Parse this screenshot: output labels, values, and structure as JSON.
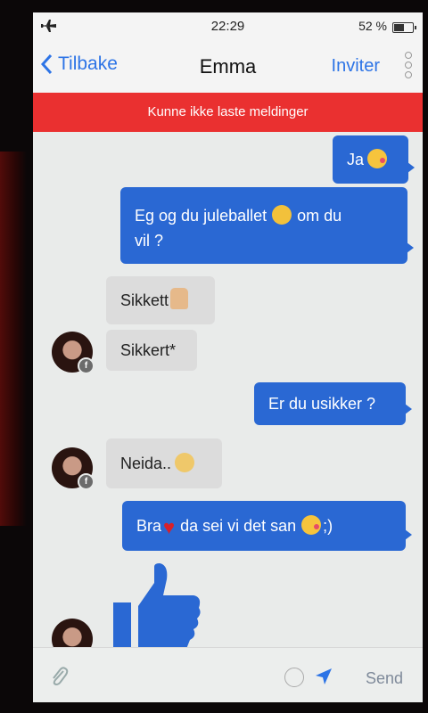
{
  "status": {
    "time": "22:29",
    "battery": "52 %",
    "battery_level": 0.52
  },
  "nav": {
    "back_label": "Tilbake",
    "title": "Emma",
    "invite_label": "Inviter"
  },
  "banner": {
    "text": "Kunne ikke laste meldinger"
  },
  "messages": [
    {
      "dir": "out",
      "text": "Ja",
      "emoji": "wink-kiss-emoji"
    },
    {
      "dir": "out",
      "text_1": "Eg og du juleballet",
      "emoji": "smiley-emoji",
      "text_2": "om du",
      "text_3": "vil ?"
    },
    {
      "dir": "in",
      "text": "Sikkett",
      "emoji": "thumbs-up-emoji"
    },
    {
      "dir": "in",
      "text": "Sikkert*"
    },
    {
      "dir": "out",
      "text": "Er du usikker ?"
    },
    {
      "dir": "in",
      "text": "Neida..",
      "emoji": "relieved-emoji"
    },
    {
      "dir": "out",
      "text_1": "Bra",
      "emoji_1": "heart-emoji",
      "text_2": "da sei vi det san",
      "emoji_2": "wink-kiss-emoji",
      "text_3": ";)"
    },
    {
      "dir": "out",
      "sticker": "thumbs-up-sticker"
    }
  ],
  "input": {
    "send_label": "Send"
  },
  "colors": {
    "accent": "#2d74e6",
    "outgoing": "#2a68d3",
    "banner": "#ea3030",
    "incoming": "#dcdcdc"
  }
}
